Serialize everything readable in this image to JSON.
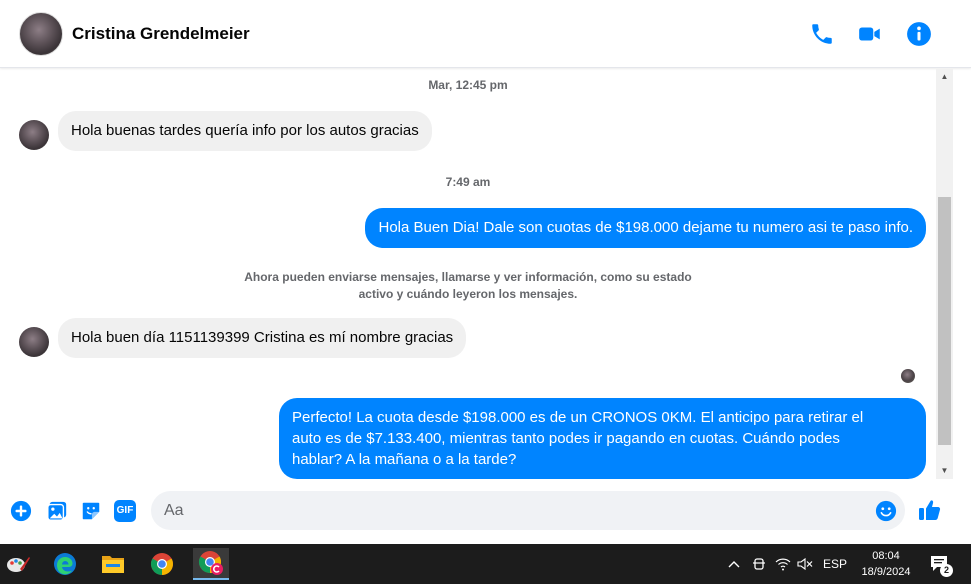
{
  "header": {
    "contact_name": "Cristina Grendelmeier",
    "icons": [
      "phone-icon",
      "video-call-icon",
      "info-icon"
    ],
    "accent": "#0084ff"
  },
  "conversation": {
    "time_1": "Mar, 12:45 pm",
    "msg_1": "Hola buenas tardes quería info por los autos gracias",
    "time_2": "7:49 am",
    "msg_2": "Hola Buen Dia! Dale son cuotas de $198.000 dejame tu numero asi te paso info.",
    "notice_line1": "Ahora pueden enviarse mensajes, llamarse y ver información, como su estado",
    "notice_line2": "activo y cuándo leyeron los mensajes.",
    "msg_3": "Hola buen día 1151139399 Cristina es mí nombre gracias",
    "msg_4_line1": "Perfecto! La cuota desde $198.000 es de un CRONOS 0KM. El anticipo para retirar el",
    "msg_4_line2": "auto es de $7.133.400, mientras tanto podes ir pagando en cuotas. Cuándo podes",
    "msg_4_line3": "hablar? A la mañana o a la tarde?"
  },
  "composer": {
    "placeholder": "Aa",
    "icons": [
      "plus-icon",
      "image-icon",
      "sticker-icon",
      "gif-icon",
      "emoji-icon",
      "thumbs-up-icon"
    ],
    "gif_label": "GIF"
  },
  "taskbar": {
    "apps": [
      "paint-app-icon",
      "edge-icon",
      "file-explorer-icon",
      "chrome-icon",
      "chrome-profile-icon"
    ],
    "language": "ESP",
    "time": "08:04",
    "date": "18/9/2024",
    "notification_count": "2"
  }
}
